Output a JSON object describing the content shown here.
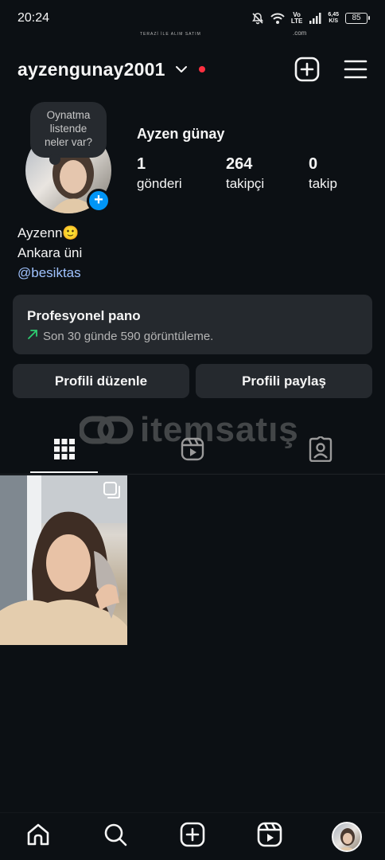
{
  "status_bar": {
    "time": "20:24",
    "network_speed_value": "6,45",
    "network_speed_unit": "K/S",
    "volte_line1": "Vo",
    "volte_line2": "LTE",
    "battery": "85",
    "icons": [
      "mute-icon",
      "wifi-icon",
      "signal-icon"
    ]
  },
  "header": {
    "username": "ayzengunay2001",
    "icons": [
      "chevron-down-icon",
      "notification-dot",
      "create-icon",
      "menu-icon"
    ],
    "dot_color": "#ff3040"
  },
  "profile": {
    "note_line1": "Oynatma",
    "note_line2": "listende",
    "note_line3": "neler var?",
    "add_story_symbol": "+",
    "full_name": "Ayzen günay",
    "stats": {
      "posts_count": "1",
      "posts_label": "gönderi",
      "followers_count": "264",
      "followers_label": "takipçi",
      "following_count": "0",
      "following_label": "takip"
    },
    "bio_line1": "Ayzenn🙂",
    "bio_line2": "Ankara üni",
    "bio_link": "@besiktas"
  },
  "professional_dashboard": {
    "title": "Profesyonel pano",
    "subtitle": "Son 30 günde 590 görüntüleme.",
    "trend_color": "#2ecc71"
  },
  "actions": {
    "edit_profile": "Profili düzenle",
    "share_profile": "Profili paylaş"
  },
  "watermark": {
    "text": "itemsatış",
    "tag": "TERAZİ İLE ALIM SATIM",
    "suffix": ".com"
  },
  "tabs": [
    {
      "name": "grid",
      "icon": "grid-icon",
      "active": true
    },
    {
      "name": "reels",
      "icon": "reels-icon",
      "active": false
    },
    {
      "name": "tagged",
      "icon": "tagged-icon",
      "active": false
    }
  ],
  "posts": [
    {
      "type": "carousel",
      "icon": "multiple-photos-icon"
    }
  ],
  "bottom_nav": [
    "home-icon",
    "search-icon",
    "create-icon",
    "reels-icon",
    "profile-avatar"
  ],
  "colors": {
    "background": "#0c1014",
    "card": "#25292e",
    "link": "#a0c3ff",
    "accent_blue": "#0095f6"
  }
}
